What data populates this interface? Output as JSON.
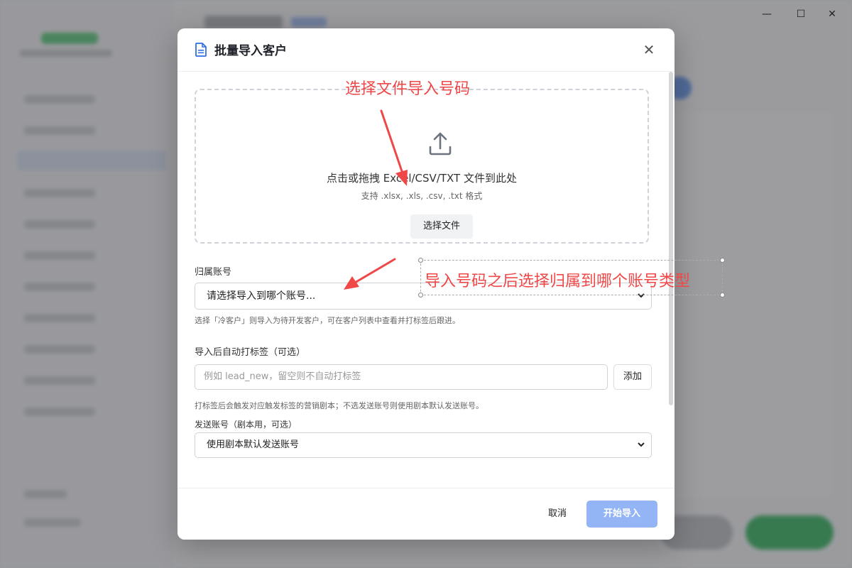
{
  "window_controls": {
    "minimize": "—",
    "maximize": "☐",
    "close": "✕"
  },
  "modal": {
    "title": "批量导入客户",
    "title_icon": "spreadsheet-file-icon",
    "close_icon": "close-icon"
  },
  "dropzone": {
    "icon": "upload-icon",
    "main_text": "点击或拖拽 Excel/CSV/TXT 文件到此处",
    "sub_text": "支持 .xlsx, .xls, .csv, .txt 格式",
    "choose_button": "选择文件"
  },
  "account": {
    "label": "归属账号",
    "placeholder": "请选择导入到哪个账号...",
    "hint": "选择「冷客户」则导入为待开发客户，可在客户列表中查看并打标签后跟进。"
  },
  "tags": {
    "label": "导入后自动打标签（可选）",
    "placeholder": "例如 lead_new，留空则不自动打标签",
    "add_button": "添加",
    "hint": "打标签后会触发对应触发标签的营销剧本；不选发送账号则使用剧本默认发送账号。"
  },
  "send_account": {
    "label": "发送账号（剧本用，可选）",
    "value": "使用剧本默认发送账号"
  },
  "footer": {
    "cancel": "取消",
    "start": "开始导入"
  },
  "annotations": {
    "top": "选择文件导入号码",
    "right": "导入号码之后选择归属到哪个账号类型",
    "color": "#f04848"
  }
}
